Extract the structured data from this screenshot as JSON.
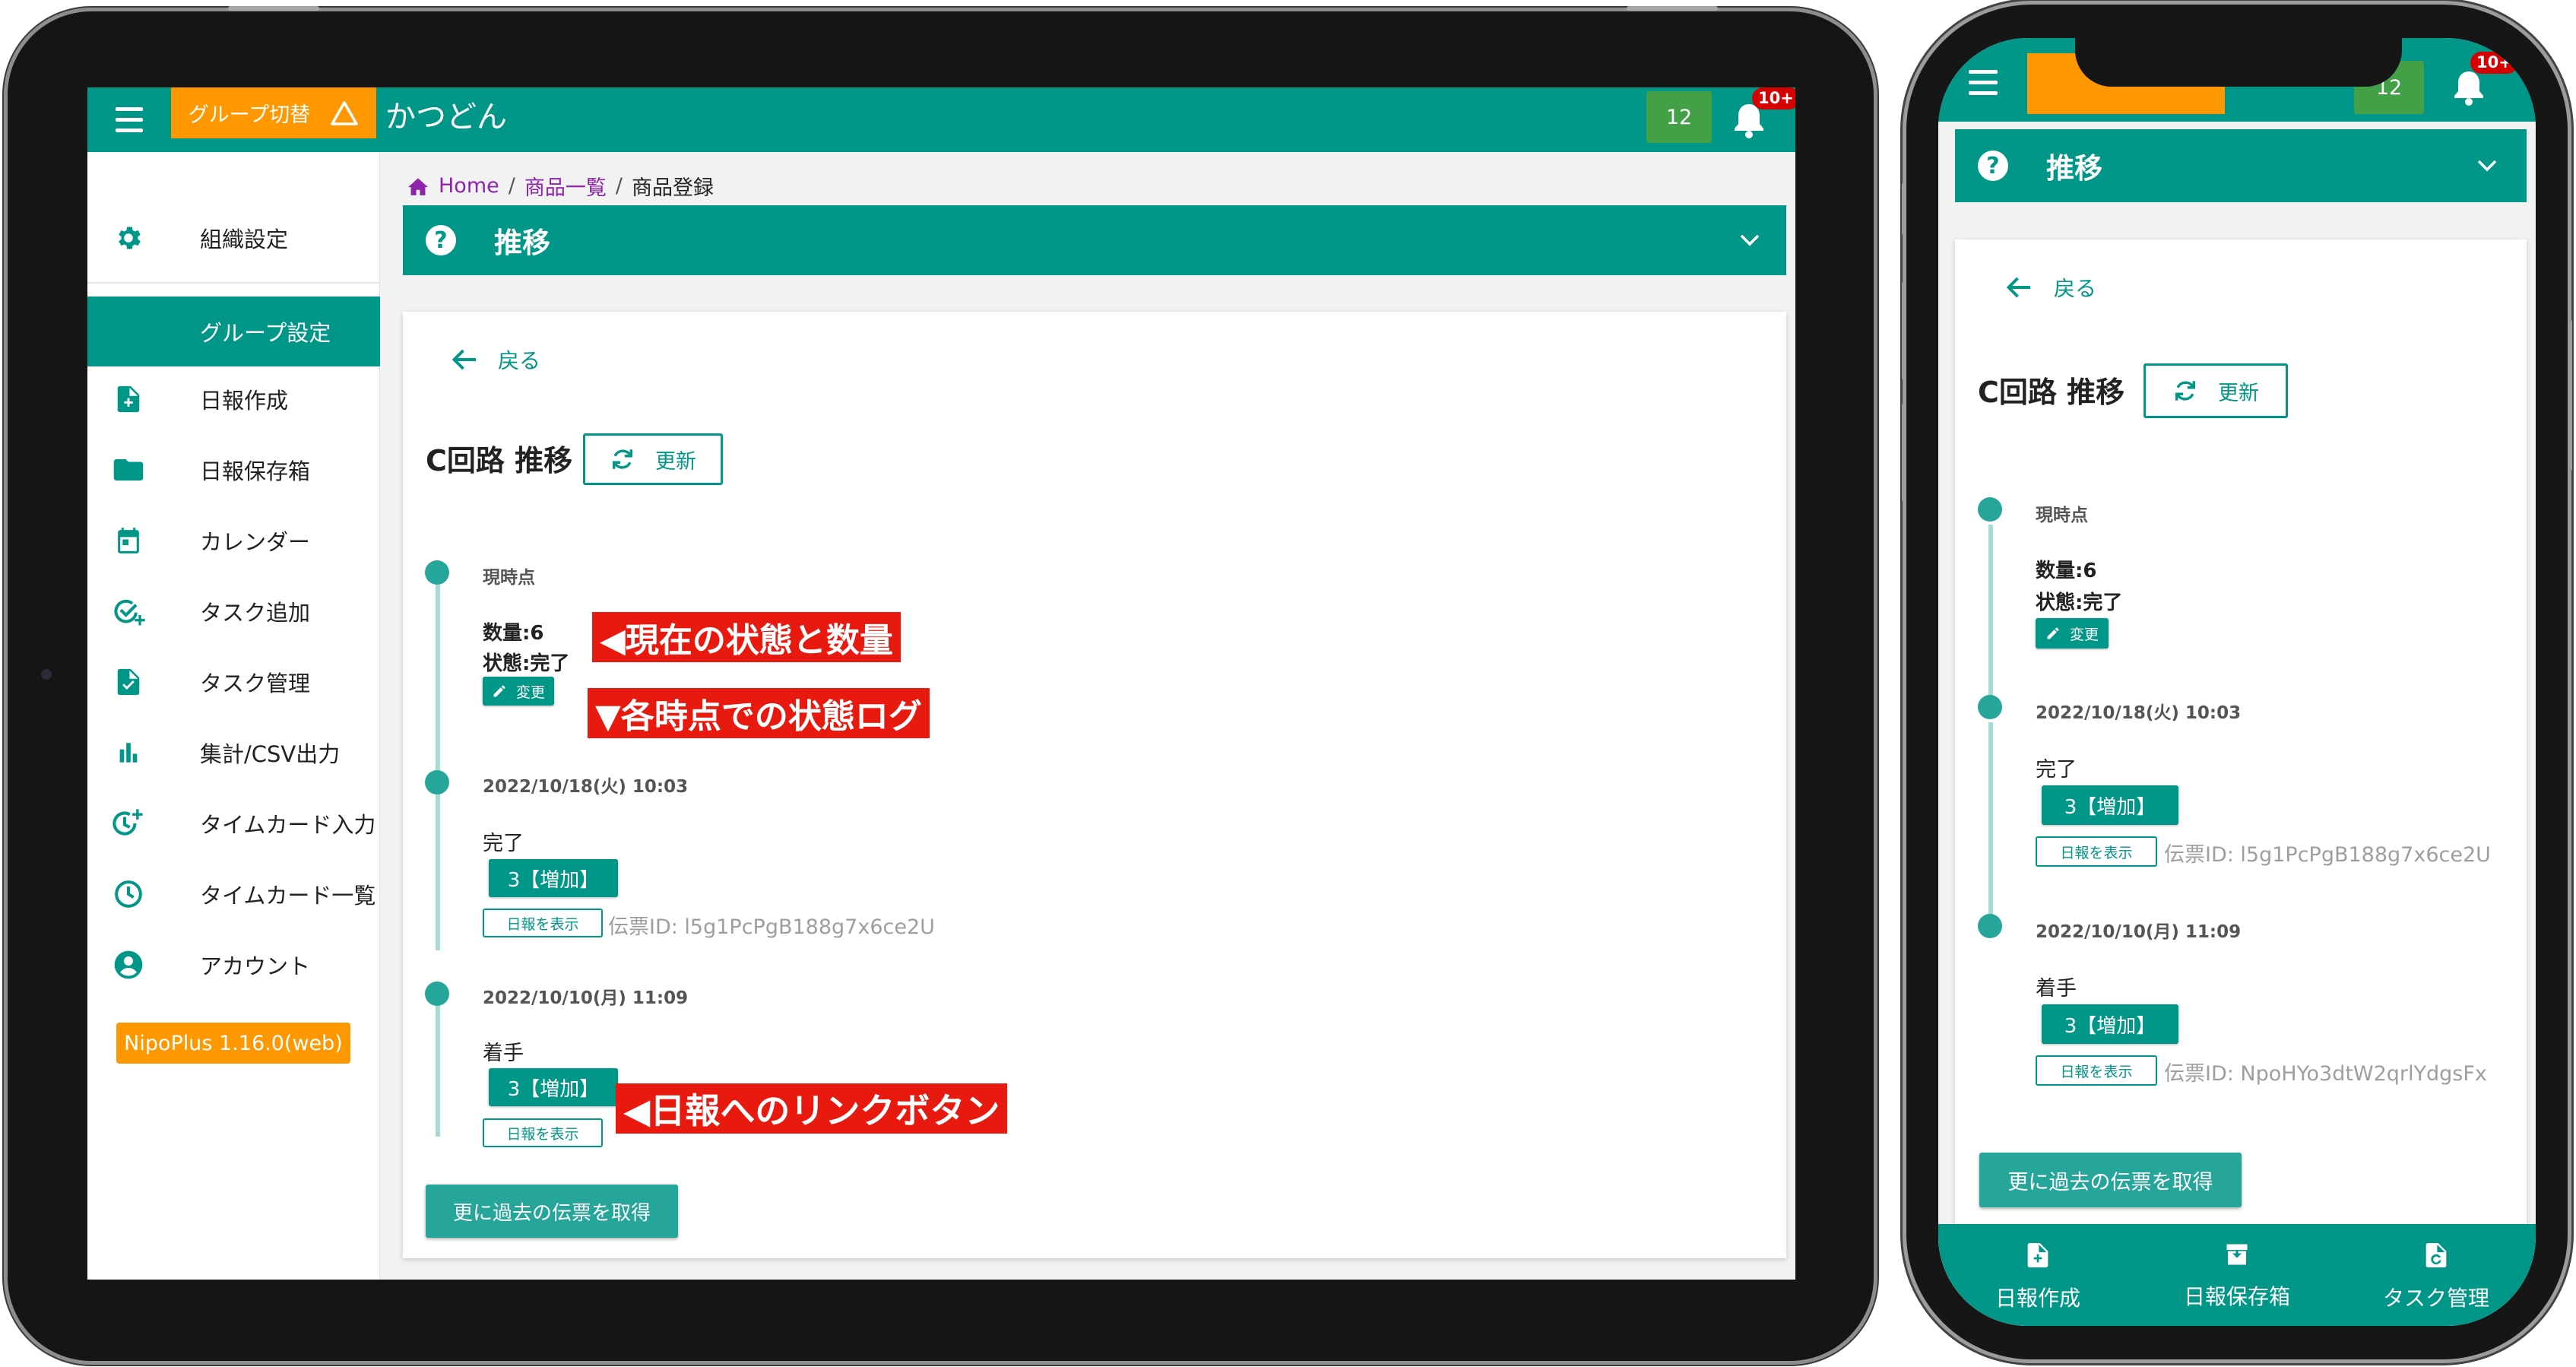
{
  "tablet": {
    "topbar": {
      "group_switch_label": "グループ切替",
      "app_name": "かつどん",
      "count_badge": "12",
      "notification_count": "10+"
    },
    "sidebar": {
      "items": [
        {
          "label": "組織設定",
          "icon": "gear-icon"
        },
        {
          "label": "グループ設定",
          "icon": "",
          "active": true
        },
        {
          "label": "日報作成",
          "icon": "note-add-icon"
        },
        {
          "label": "日報保存箱",
          "icon": "folder-icon"
        },
        {
          "label": "カレンダー",
          "icon": "calendar-icon"
        },
        {
          "label": "タスク追加",
          "icon": "task-add-icon"
        },
        {
          "label": "タスク管理",
          "icon": "task-manage-icon"
        },
        {
          "label": "集計/CSV出力",
          "icon": "bar-chart-icon"
        },
        {
          "label": "タイムカード入力",
          "icon": "timecard-add-icon"
        },
        {
          "label": "タイムカード一覧",
          "icon": "clock-icon"
        },
        {
          "label": "アカウント",
          "icon": "account-icon"
        }
      ],
      "version": "NipoPlus 1.16.0(web)"
    },
    "breadcrumb": {
      "home": "Home",
      "list": "商品一覧",
      "current": "商品登録"
    },
    "accordion_title": "推移",
    "back_label": "戻る",
    "page_title": "C回路 推移",
    "refresh_label": "更新",
    "timeline": {
      "current": {
        "heading": "現時点",
        "quantity": "数量:6",
        "status": "状態:完了",
        "change_label": "変更"
      },
      "entries": [
        {
          "datetime": "2022/10/18(火) 10:03",
          "status": "完了",
          "chip": "3【増加】",
          "report_button": "日報を表示",
          "slip_id": "伝票ID: l5g1PcPgB188g7x6ce2U"
        },
        {
          "datetime": "2022/10/10(月) 11:09",
          "status": "着手",
          "chip": "3【増加】",
          "report_button": "日報を表示",
          "slip_id": ""
        }
      ]
    },
    "more_button": "更に過去の伝票を取得",
    "annotations": {
      "current_state": "◀現在の状態と数量",
      "state_log": "▼各時点での状態ログ",
      "report_link": "◀日報へのリンクボタン"
    }
  },
  "phone": {
    "topbar": {
      "group_switch_label": "",
      "count_badge": "12",
      "notification_count": "10+"
    },
    "accordion_title": "推移",
    "back_label": "戻る",
    "page_title": "C回路 推移",
    "refresh_label": "更新",
    "timeline": {
      "current": {
        "heading": "現時点",
        "quantity": "数量:6",
        "status": "状態:完了",
        "change_label": "変更"
      },
      "entries": [
        {
          "datetime": "2022/10/18(火) 10:03",
          "status": "完了",
          "chip": "3【増加】",
          "report_button": "日報を表示",
          "slip_id": "伝票ID: l5g1PcPgB188g7x6ce2U"
        },
        {
          "datetime": "2022/10/10(月) 11:09",
          "status": "着手",
          "chip": "3【増加】",
          "report_button": "日報を表示",
          "slip_id": "伝票ID: NpoHYo3dtW2qrlYdgsFx"
        }
      ]
    },
    "more_button": "更に過去の伝票を取得",
    "bottom_nav": [
      {
        "label": "日報作成",
        "icon": "note-add-icon"
      },
      {
        "label": "日報保存箱",
        "icon": "archive-icon"
      },
      {
        "label": "タスク管理",
        "icon": "task-manage-icon"
      }
    ]
  },
  "colors": {
    "primary": "#009688",
    "accent_orange": "#ff9800",
    "badge_green": "#43a047",
    "annotation_red": "#e8190f",
    "notification_red": "#d50000"
  }
}
